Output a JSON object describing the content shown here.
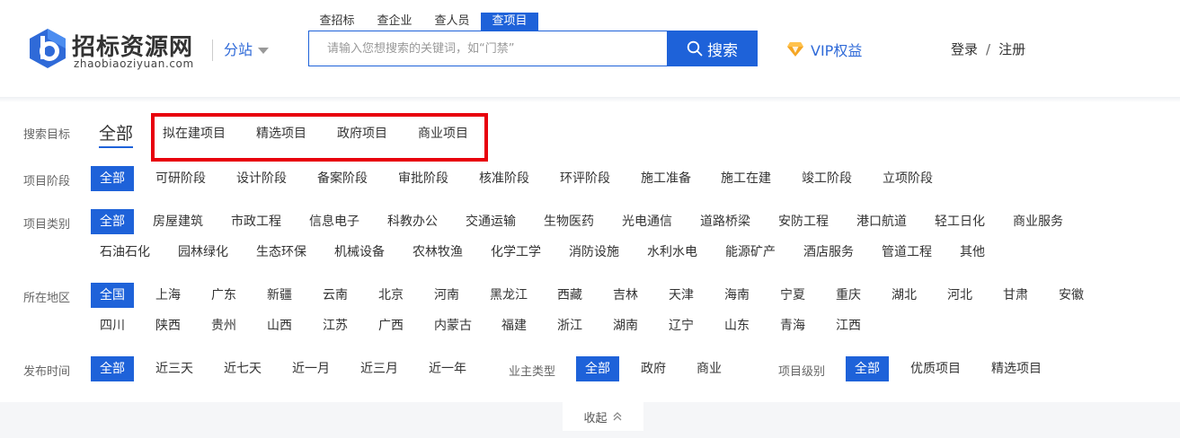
{
  "brand": {
    "name": "招标资源网",
    "domain": "zhaobiaoziyuan.com",
    "branch_label": "分站",
    "colors": {
      "primary": "#1e62d9",
      "link": "#2f6ad8",
      "highlight": "#e8000b",
      "vip": "#f5a623"
    }
  },
  "search": {
    "tabs": [
      "查招标",
      "查企业",
      "查人员",
      "查项目"
    ],
    "active_tab": "查项目",
    "placeholder": "请输入您想搜索的关键词，如“门禁”",
    "button_label": "搜索"
  },
  "header": {
    "vip_label": "VIP权益",
    "login": "登录",
    "separator": "/",
    "register": "注册"
  },
  "filters": {
    "target": {
      "label": "搜索目标",
      "all": "全部",
      "options": [
        "拟在建项目",
        "精选项目",
        "政府项目",
        "商业项目"
      ]
    },
    "stage": {
      "label": "项目阶段",
      "options": [
        "全部",
        "可研阶段",
        "设计阶段",
        "备案阶段",
        "审批阶段",
        "核准阶段",
        "环评阶段",
        "施工准备",
        "施工在建",
        "竣工阶段",
        "立项阶段"
      ]
    },
    "category": {
      "label": "项目类别",
      "row1": [
        "全部",
        "房屋建筑",
        "市政工程",
        "信息电子",
        "科教办公",
        "交通运输",
        "生物医药",
        "光电通信",
        "道路桥梁",
        "安防工程",
        "港口航道",
        "轻工日化",
        "商业服务"
      ],
      "row2": [
        "石油石化",
        "园林绿化",
        "生态环保",
        "机械设备",
        "农林牧渔",
        "化学工学",
        "消防设施",
        "水利水电",
        "能源矿产",
        "酒店服务",
        "管道工程",
        "其他"
      ]
    },
    "region": {
      "label": "所在地区",
      "row1": [
        "全国",
        "上海",
        "广东",
        "新疆",
        "云南",
        "北京",
        "河南",
        "黑龙江",
        "西藏",
        "吉林",
        "天津",
        "海南",
        "宁夏",
        "重庆",
        "湖北",
        "河北",
        "甘肃",
        "安徽"
      ],
      "row2": [
        "四川",
        "陕西",
        "贵州",
        "山西",
        "江苏",
        "广西",
        "内蒙古",
        "福建",
        "浙江",
        "湖南",
        "辽宁",
        "山东",
        "青海",
        "江西"
      ]
    },
    "time": {
      "label": "发布时间",
      "options": [
        "全部",
        "近三天",
        "近七天",
        "近一月",
        "近三月",
        "近一年"
      ]
    },
    "owner": {
      "label": "业主类型",
      "options": [
        "全部",
        "政府",
        "商业"
      ]
    },
    "level": {
      "label": "项目级别",
      "options": [
        "全部",
        "优质项目",
        "精选项目"
      ]
    }
  },
  "collapse_label": "收起"
}
